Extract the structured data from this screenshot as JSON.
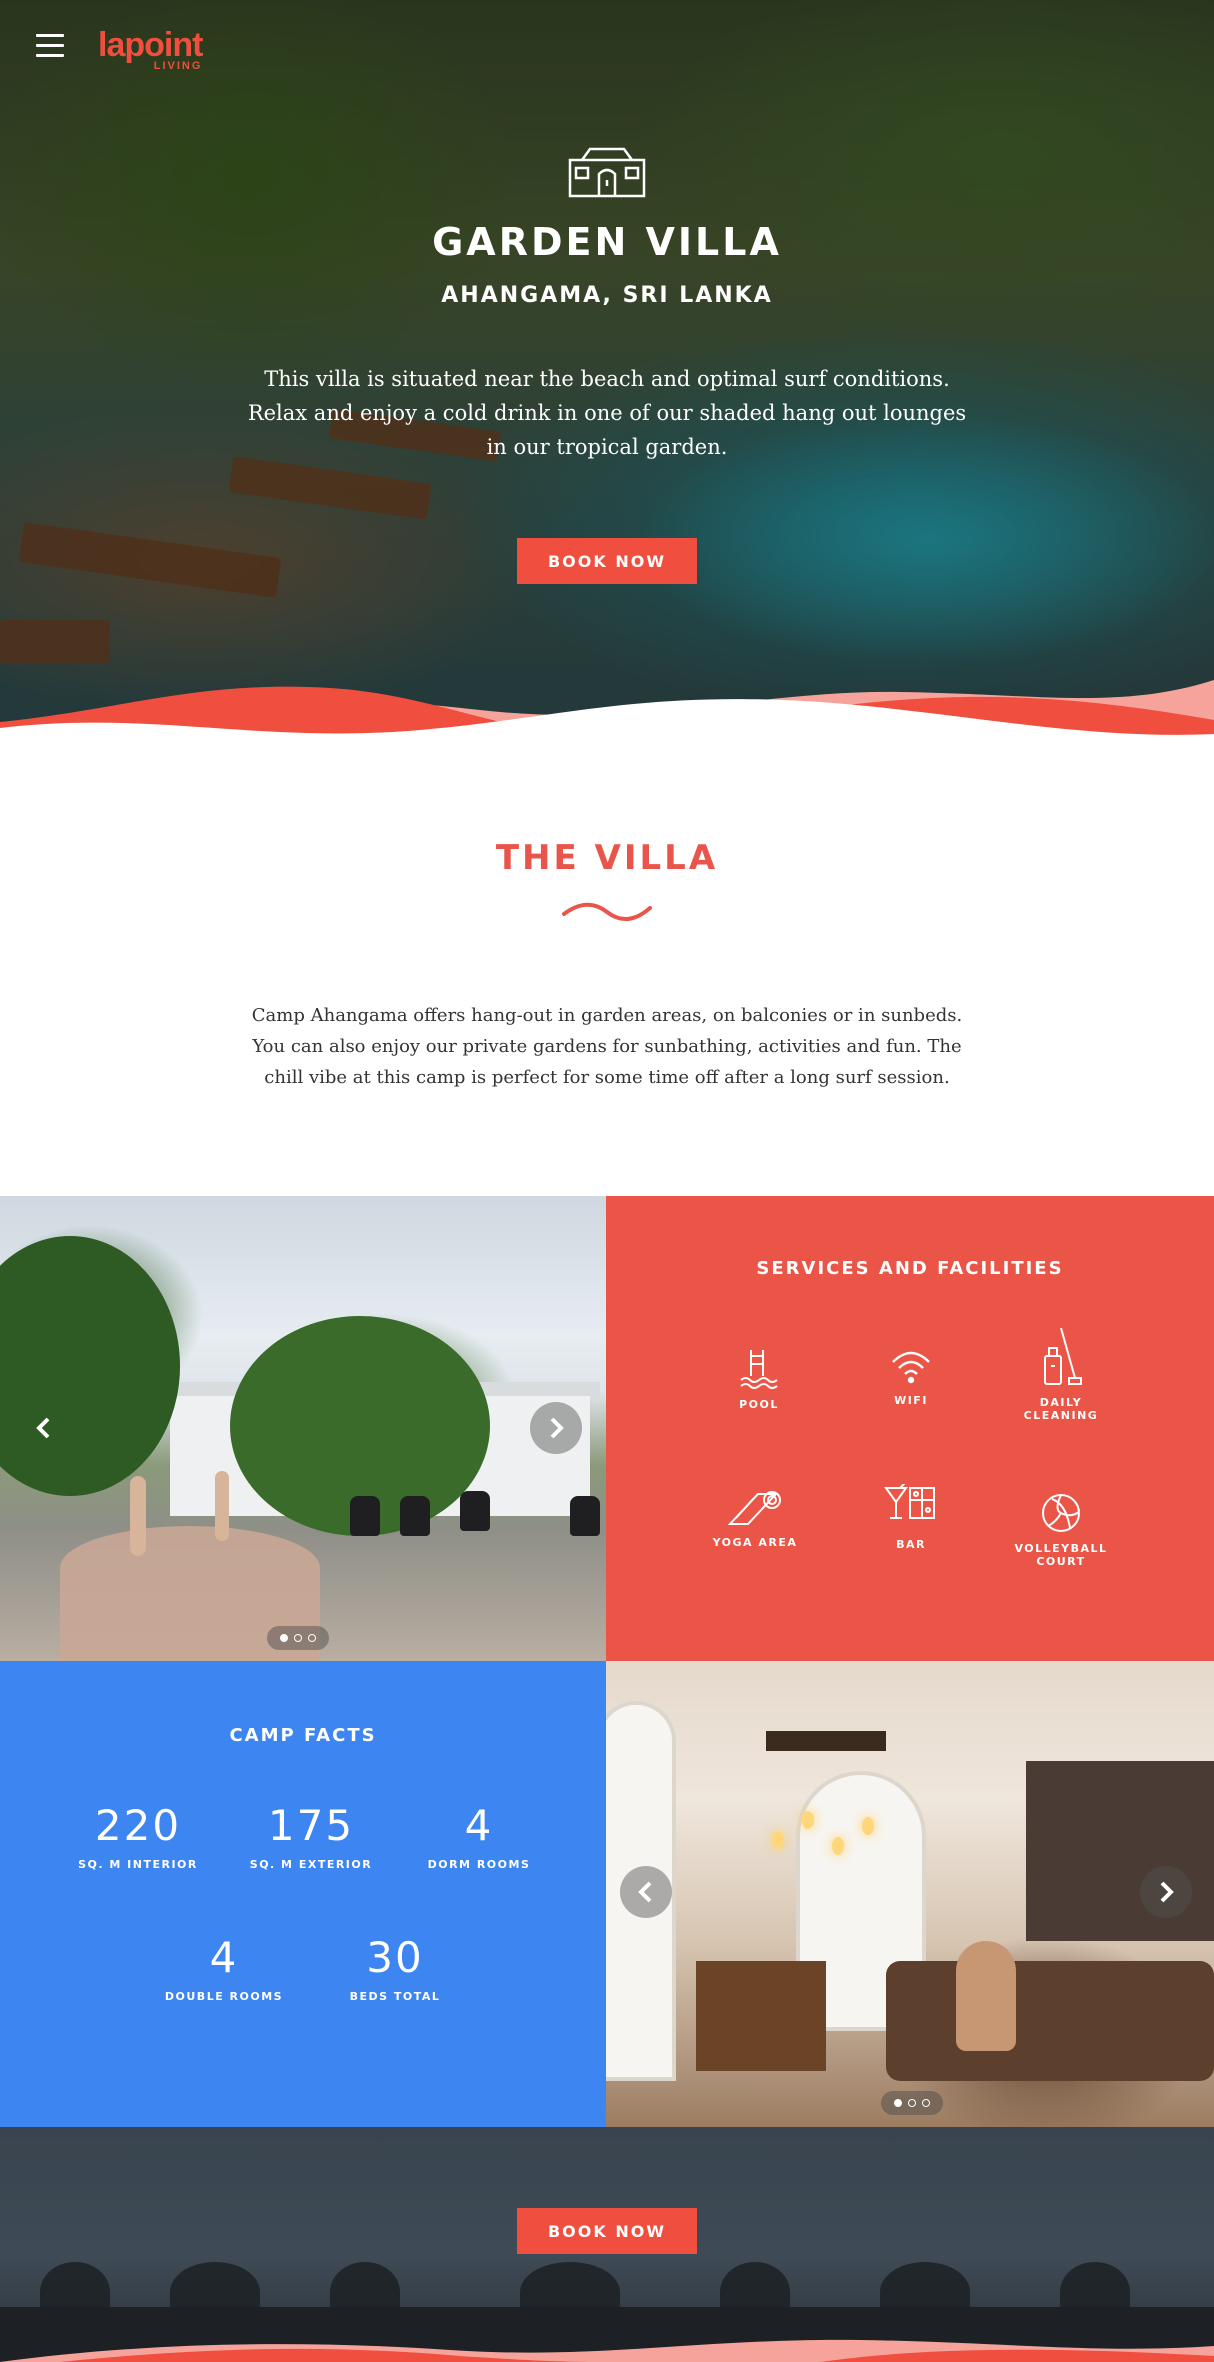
{
  "brand": {
    "logo_main": "lapoint",
    "logo_sub": "LIVING",
    "accent": "#f04e3e",
    "blue": "#3d85f0"
  },
  "nav": {
    "menu_icon": "hamburger-icon"
  },
  "hero": {
    "icon": "villa-icon",
    "title": "GARDEN VILLA",
    "subtitle": "AHANGAMA, SRI LANKA",
    "description": "This villa is situated near the beach and optimal surf conditions. Relax and enjoy a cold drink in one of our shaded hang out lounges in our tropical garden.",
    "cta": "BOOK NOW"
  },
  "villa": {
    "heading": "THE VILLA",
    "description": "Camp Ahangama offers hang-out in garden areas, on balconies or in sunbeds. You can also enjoy our private gardens for sunbathing, activities and fun. The chill vibe at this camp is perfect for some time off after a long surf session."
  },
  "services": {
    "title": "SERVICES AND FACILITIES",
    "items": [
      {
        "label": "POOL",
        "icon": "pool-icon"
      },
      {
        "label": "WIFI",
        "icon": "wifi-icon"
      },
      {
        "label": "DAILY\nCLEANING",
        "icon": "cleaning-icon"
      },
      {
        "label": "YOGA AREA",
        "icon": "yoga-mat-icon"
      },
      {
        "label": "BAR",
        "icon": "cocktail-icon"
      },
      {
        "label": "VOLLEYBALL\nCOURT",
        "icon": "volleyball-icon"
      }
    ]
  },
  "facts": {
    "title": "CAMP FACTS",
    "items": [
      {
        "value": "220",
        "label": "SQ. M INTERIOR"
      },
      {
        "value": "175",
        "label": "SQ. M EXTERIOR"
      },
      {
        "value": "4",
        "label": "DORM ROOMS"
      },
      {
        "value": "4",
        "label": "DOUBLE ROOMS"
      },
      {
        "value": "30",
        "label": "BEDS TOTAL"
      }
    ]
  },
  "carousels": {
    "exterior": {
      "slides": 3,
      "active": 1,
      "prev_icon": "chevron-left-icon",
      "next_icon": "chevron-right-icon"
    },
    "interior": {
      "slides": 3,
      "active": 1,
      "prev_icon": "chevron-left-icon",
      "next_icon": "chevron-right-icon"
    }
  },
  "footer_cta": {
    "label": "BOOK NOW"
  }
}
